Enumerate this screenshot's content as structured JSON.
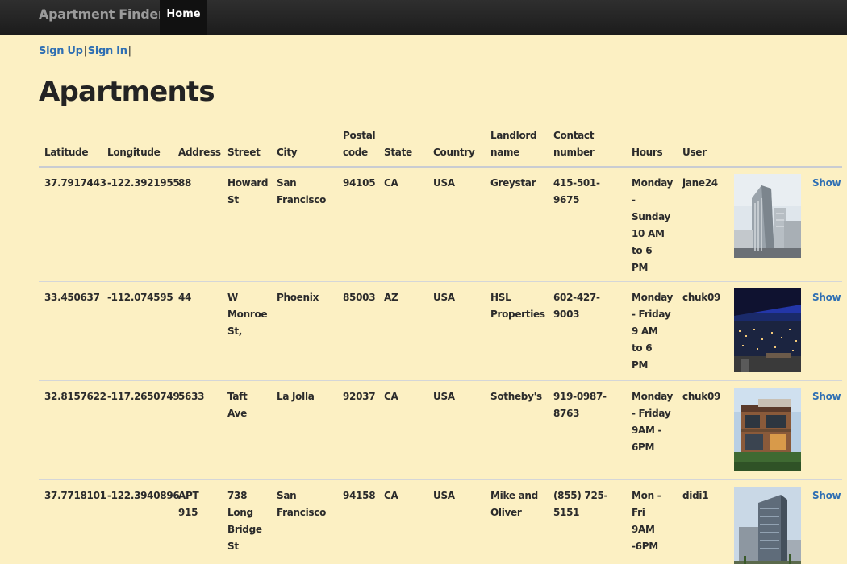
{
  "nav": {
    "brand": "Apartment Finder",
    "home": "Home"
  },
  "auth": {
    "sign_up": "Sign Up",
    "sign_in": "Sign In"
  },
  "page_title": "Apartments",
  "table": {
    "headers": {
      "latitude": "Latitude",
      "longitude": "Longitude",
      "address": "Address",
      "street": "Street",
      "city": "City",
      "postal_code": "Postal code",
      "state": "State",
      "country": "Country",
      "landlord": "Landlord name",
      "contact": "Contact number",
      "hours": "Hours",
      "user": "User"
    },
    "rows": [
      {
        "latitude": "37.7917443",
        "longitude": "-122.3921955",
        "address": "88",
        "street": "Howard St",
        "city": "San Francisco",
        "postal_code": "94105",
        "state": "CA",
        "country": "USA",
        "landlord": "Greystar",
        "contact": "415-501-9675",
        "hours": "Monday - Sunday 10 AM to 6 PM",
        "user": "jane24",
        "show": "Show"
      },
      {
        "latitude": "33.450637",
        "longitude": "-112.074595",
        "address": "44",
        "street": "W Monroe St,",
        "city": "Phoenix",
        "postal_code": "85003",
        "state": "AZ",
        "country": "USA",
        "landlord": "HSL Properties",
        "contact": "602-427-9003",
        "hours": "Monday - Friday 9 AM to 6 PM",
        "user": "chuk09",
        "show": "Show"
      },
      {
        "latitude": "32.8157622",
        "longitude": "-117.2650749",
        "address": "5633",
        "street": "Taft Ave",
        "city": "La Jolla",
        "postal_code": "92037",
        "state": "CA",
        "country": "USA",
        "landlord": "Sotheby's",
        "contact": "919-0987-8763",
        "hours": "Monday - Friday 9AM - 6PM",
        "user": "chuk09",
        "show": "Show"
      },
      {
        "latitude": "37.7718101",
        "longitude": "-122.3940896",
        "address": "APT 915",
        "street": "738 Long Bridge St",
        "city": "San Francisco",
        "postal_code": "94158",
        "state": "CA",
        "country": "USA",
        "landlord": "Mike and Oliver",
        "contact": "(855) 725-5151",
        "hours": "Mon - Fri 9AM -6PM",
        "user": "didi1",
        "show": "Show"
      }
    ]
  }
}
